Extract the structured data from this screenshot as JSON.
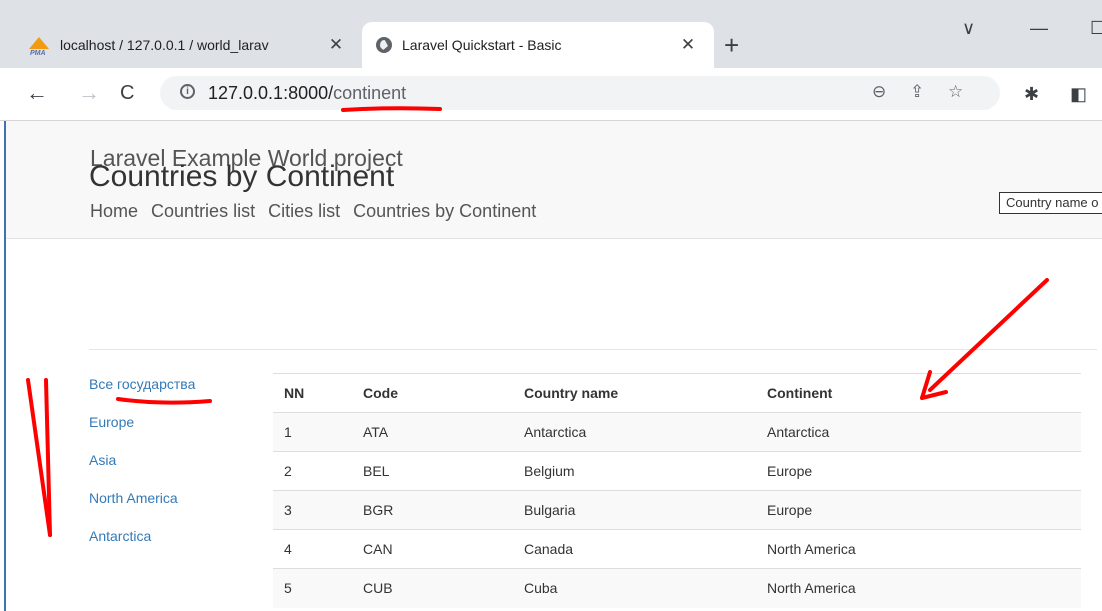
{
  "browser": {
    "tabs": [
      {
        "title": "localhost / 127.0.0.1 / world_larav",
        "icon": "phpmyadmin-icon",
        "active": false
      },
      {
        "title": "Laravel Quickstart - Basic",
        "icon": "globe-icon",
        "active": true
      }
    ],
    "new_tab": "+",
    "window_controls": {
      "dropdown": "∨",
      "minimize": "—",
      "maximize": "☐"
    },
    "url_host": "127.0.0.1:8000/",
    "url_path": "continent"
  },
  "site": {
    "brand": "Laravel Example World project",
    "nav": [
      "Home",
      "Countries list",
      "Cities list",
      "Countries by Continent"
    ],
    "search_placeholder": "Country name o"
  },
  "page": {
    "heading": "Countries by Continent",
    "continents": [
      "Все государства",
      "Europe",
      "Asia",
      "North America",
      "Antarctica"
    ],
    "table": {
      "headers": [
        "NN",
        "Code",
        "Country name",
        "Continent"
      ],
      "rows": [
        [
          "1",
          "ATA",
          "Antarctica",
          "Antarctica"
        ],
        [
          "2",
          "BEL",
          "Belgium",
          "Europe"
        ],
        [
          "3",
          "BGR",
          "Bulgaria",
          "Europe"
        ],
        [
          "4",
          "CAN",
          "Canada",
          "North America"
        ],
        [
          "5",
          "CUB",
          "Cuba",
          "North America"
        ]
      ]
    }
  },
  "colors": {
    "link": "#337ab7",
    "annotation": "#ff0000",
    "frame": "#3d72b3"
  }
}
